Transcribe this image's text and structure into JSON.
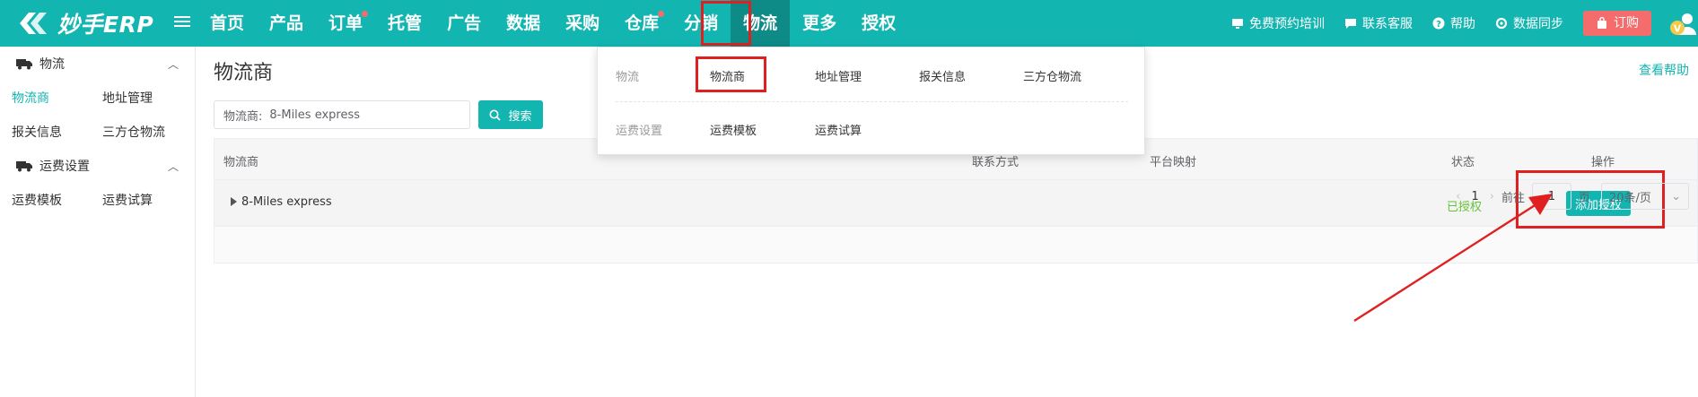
{
  "app": {
    "logo_text": "妙手ERP"
  },
  "nav": {
    "items": [
      {
        "label": "首页",
        "active": false,
        "dot": false
      },
      {
        "label": "产品",
        "active": false,
        "dot": false
      },
      {
        "label": "订单",
        "active": false,
        "dot": true
      },
      {
        "label": "托管",
        "active": false,
        "dot": false
      },
      {
        "label": "广告",
        "active": false,
        "dot": false
      },
      {
        "label": "数据",
        "active": false,
        "dot": false
      },
      {
        "label": "采购",
        "active": false,
        "dot": false
      },
      {
        "label": "仓库",
        "active": false,
        "dot": true
      },
      {
        "label": "分销",
        "active": false,
        "dot": false
      },
      {
        "label": "物流",
        "active": true,
        "dot": false
      },
      {
        "label": "更多",
        "active": false,
        "dot": false
      },
      {
        "label": "授权",
        "active": false,
        "dot": false
      }
    ]
  },
  "top_right": {
    "training": "免费预约培训",
    "support": "联系客服",
    "help": "帮助",
    "sync": "数据同步",
    "order": "订购",
    "avatar_badge": "V"
  },
  "sidebar": {
    "groups": [
      {
        "title": "物流",
        "icon": "truck-icon",
        "rows": [
          [
            "物流商",
            "地址管理"
          ],
          [
            "报关信息",
            "三方仓物流"
          ]
        ]
      },
      {
        "title": "运费设置",
        "icon": "truck-icon",
        "rows": [
          [
            "运费模板",
            "运费试算"
          ]
        ]
      }
    ],
    "active_item": "物流商"
  },
  "main": {
    "title": "物流商",
    "help_link": "查看帮助",
    "search": {
      "label": "物流商:",
      "value": "8-Miles express",
      "button": "搜索"
    },
    "table": {
      "headers": {
        "carrier": "物流商",
        "contact": "联系方式",
        "platform": "平台映射",
        "status": "状态",
        "action": "操作"
      },
      "rows": [
        {
          "carrier": "8-Miles express",
          "status": "已授权",
          "action": "添加授权"
        }
      ]
    },
    "pager": {
      "current_page": "1",
      "goto_label": "前往",
      "goto_value": "1",
      "page_suffix": "页",
      "page_size": "20条/页"
    }
  },
  "dropdown": {
    "row1": {
      "label": "物流",
      "items": [
        "物流商",
        "地址管理",
        "报关信息",
        "三方仓物流"
      ]
    },
    "row2": {
      "label": "运费设置",
      "items": [
        "运费模板",
        "运费试算"
      ]
    }
  },
  "colors": {
    "primary": "#13b5b1",
    "active_nav": "#0e8a87",
    "danger": "#f56c6c",
    "success": "#67c23a",
    "annotation": "#e02020"
  }
}
